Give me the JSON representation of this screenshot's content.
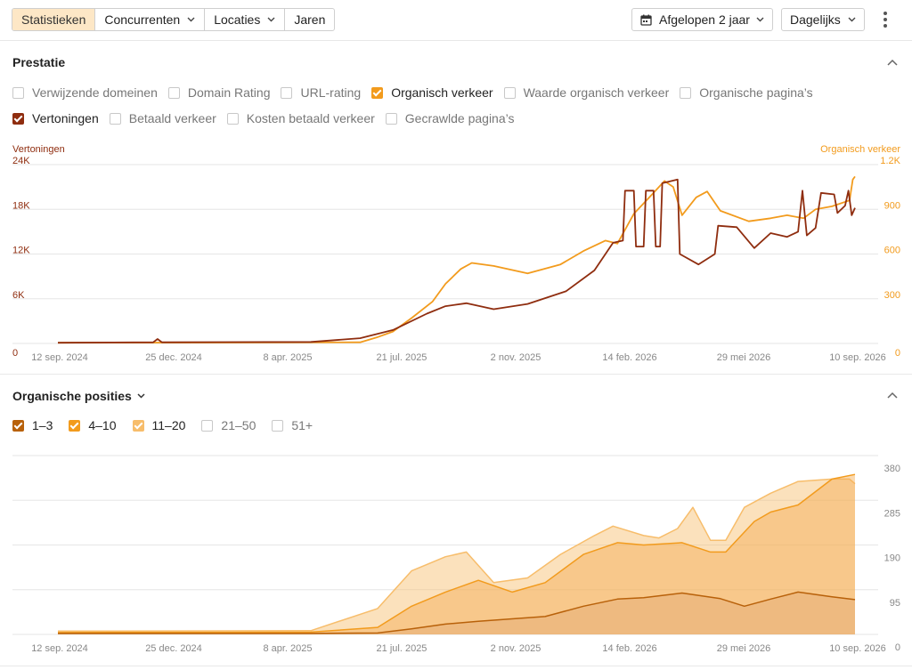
{
  "toolbar": {
    "tabs": [
      {
        "label": "Statistieken",
        "active": true,
        "has_dropdown": false
      },
      {
        "label": "Concurrenten",
        "active": false,
        "has_dropdown": true
      },
      {
        "label": "Locaties",
        "active": false,
        "has_dropdown": true
      },
      {
        "label": "Jaren",
        "active": false,
        "has_dropdown": false
      }
    ],
    "period_label": "Afgelopen 2 jaar",
    "interval_label": "Dagelijks",
    "icons": {
      "period": "calendar-icon",
      "chevron": "chevron-down-icon",
      "more": "kebab-menu-icon"
    }
  },
  "performance": {
    "title": "Prestatie",
    "metrics": [
      {
        "label": "Verwijzende domeinen",
        "checked": false,
        "color": ""
      },
      {
        "label": "Domain Rating",
        "checked": false,
        "color": ""
      },
      {
        "label": "URL-rating",
        "checked": false,
        "color": ""
      },
      {
        "label": "Organisch verkeer",
        "checked": true,
        "color": "#f29b1d"
      },
      {
        "label": "Waarde organisch verkeer",
        "checked": false,
        "color": ""
      },
      {
        "label": "Organische pagina’s",
        "checked": false,
        "color": ""
      },
      {
        "label": "Vertoningen",
        "checked": true,
        "color": "#8f2d0f"
      },
      {
        "label": "Betaald verkeer",
        "checked": false,
        "color": ""
      },
      {
        "label": "Kosten betaald verkeer",
        "checked": false,
        "color": ""
      },
      {
        "label": "Gecrawlde pagina’s",
        "checked": false,
        "color": ""
      }
    ],
    "left_axis_title": "Vertoningen",
    "right_axis_title": "Organisch verkeer"
  },
  "positions": {
    "title": "Organische posities",
    "buckets": [
      {
        "label": "1–3",
        "checked": true,
        "color": "#b8610a"
      },
      {
        "label": "4–10",
        "checked": true,
        "color": "#f29b1d"
      },
      {
        "label": "11–20",
        "checked": true,
        "color": "#f7bd6b"
      },
      {
        "label": "21–50",
        "checked": false,
        "color": ""
      },
      {
        "label": "51+",
        "checked": false,
        "color": ""
      }
    ]
  },
  "colors": {
    "accent": "#f29b1d",
    "accent_dark": "#8f2d0f",
    "active_tab_bg": "#fde7c6"
  },
  "chart_data": [
    {
      "type": "line",
      "x_tick_labels": [
        "12 sep. 2024",
        "25 dec. 2024",
        "8 apr. 2025",
        "21 jul. 2025",
        "2 nov. 2025",
        "14 feb. 2026",
        "29 mei 2026",
        "10 sep. 2026"
      ],
      "x_range": [
        "2024-09-12",
        "2026-09-10"
      ],
      "y_left": {
        "title": "Vertoningen",
        "ticks": [
          "0",
          "6K",
          "12K",
          "18K",
          "24K"
        ],
        "range": [
          0,
          24000
        ]
      },
      "y_right": {
        "title": "Organisch verkeer",
        "ticks": [
          "0",
          "300",
          "600",
          "900",
          "1.2K"
        ],
        "range": [
          0,
          1200
        ]
      },
      "grid": true,
      "series": [
        {
          "name": "Organisch verkeer",
          "axis": "right",
          "color": "#f29b1d",
          "points": [
            [
              "2024-09-12",
              5
            ],
            [
              "2025-06-15",
              8
            ],
            [
              "2025-06-30",
              40
            ],
            [
              "2025-07-15",
              80
            ],
            [
              "2025-08-01",
              170
            ],
            [
              "2025-08-20",
              280
            ],
            [
              "2025-09-01",
              400
            ],
            [
              "2025-09-15",
              500
            ],
            [
              "2025-09-25",
              540
            ],
            [
              "2025-10-15",
              520
            ],
            [
              "2025-11-15",
              470
            ],
            [
              "2025-12-15",
              530
            ],
            [
              "2026-01-05",
              620
            ],
            [
              "2026-01-25",
              690
            ],
            [
              "2026-02-05",
              670
            ],
            [
              "2026-02-20",
              870
            ],
            [
              "2026-03-10",
              1010
            ],
            [
              "2026-03-20",
              1090
            ],
            [
              "2026-03-28",
              1050
            ],
            [
              "2026-04-05",
              860
            ],
            [
              "2026-04-18",
              980
            ],
            [
              "2026-04-28",
              1020
            ],
            [
              "2026-05-10",
              890
            ],
            [
              "2026-06-05",
              820
            ],
            [
              "2026-06-25",
              840
            ],
            [
              "2026-07-10",
              860
            ],
            [
              "2026-07-25",
              840
            ],
            [
              "2026-08-05",
              900
            ],
            [
              "2026-08-20",
              920
            ],
            [
              "2026-09-05",
              960
            ],
            [
              "2026-09-08",
              1100
            ],
            [
              "2026-09-10",
              1120
            ]
          ]
        },
        {
          "name": "Vertoningen",
          "axis": "left",
          "color": "#8f2d0f",
          "points": [
            [
              "2024-09-12",
              100
            ],
            [
              "2024-12-08",
              150
            ],
            [
              "2024-12-12",
              600
            ],
            [
              "2024-12-16",
              150
            ],
            [
              "2025-05-01",
              200
            ],
            [
              "2025-06-15",
              700
            ],
            [
              "2025-07-15",
              1800
            ],
            [
              "2025-08-15",
              4000
            ],
            [
              "2025-09-01",
              5000
            ],
            [
              "2025-09-20",
              5400
            ],
            [
              "2025-10-15",
              4600
            ],
            [
              "2025-11-15",
              5300
            ],
            [
              "2025-12-20",
              7000
            ],
            [
              "2026-01-15",
              9800
            ],
            [
              "2026-02-01",
              13500
            ],
            [
              "2026-02-10",
              13800
            ],
            [
              "2026-02-12",
              20500
            ],
            [
              "2026-02-20",
              20500
            ],
            [
              "2026-02-22",
              13000
            ],
            [
              "2026-03-01",
              13000
            ],
            [
              "2026-03-03",
              20500
            ],
            [
              "2026-03-10",
              20500
            ],
            [
              "2026-03-12",
              13000
            ],
            [
              "2026-03-16",
              13000
            ],
            [
              "2026-03-18",
              21500
            ],
            [
              "2026-04-01",
              22000
            ],
            [
              "2026-04-03",
              12000
            ],
            [
              "2026-04-20",
              10600
            ],
            [
              "2026-05-05",
              12000
            ],
            [
              "2026-05-08",
              15800
            ],
            [
              "2026-05-25",
              15600
            ],
            [
              "2026-06-10",
              12800
            ],
            [
              "2026-06-25",
              14800
            ],
            [
              "2026-07-10",
              14300
            ],
            [
              "2026-07-20",
              15000
            ],
            [
              "2026-07-24",
              20500
            ],
            [
              "2026-07-28",
              14500
            ],
            [
              "2026-08-05",
              15500
            ],
            [
              "2026-08-10",
              20200
            ],
            [
              "2026-08-22",
              20000
            ],
            [
              "2026-08-25",
              17500
            ],
            [
              "2026-09-01",
              18500
            ],
            [
              "2026-09-04",
              20500
            ],
            [
              "2026-09-07",
              17200
            ],
            [
              "2026-09-10",
              18200
            ]
          ]
        }
      ]
    },
    {
      "type": "area",
      "stacked": true,
      "x_tick_labels": [
        "12 sep. 2024",
        "25 dec. 2024",
        "8 apr. 2025",
        "21 jul. 2025",
        "2 nov. 2025",
        "14 feb. 2026",
        "29 mei 2026",
        "10 sep. 2026"
      ],
      "x_range": [
        "2024-09-12",
        "2026-09-10"
      ],
      "y_right": {
        "ticks": [
          "0",
          "95",
          "190",
          "285",
          "380"
        ],
        "range": [
          0,
          380
        ]
      },
      "grid": true,
      "series": [
        {
          "name": "1–3",
          "color": "#b8610a",
          "points": [
            [
              "2024-09-12",
              2
            ],
            [
              "2025-05-01",
              2
            ],
            [
              "2025-07-01",
              3
            ],
            [
              "2025-08-01",
              12
            ],
            [
              "2025-09-01",
              22
            ],
            [
              "2025-10-01",
              28
            ],
            [
              "2025-11-01",
              33
            ],
            [
              "2025-12-01",
              38
            ],
            [
              "2026-01-05",
              60
            ],
            [
              "2026-02-05",
              75
            ],
            [
              "2026-03-01",
              78
            ],
            [
              "2026-04-05",
              88
            ],
            [
              "2026-05-10",
              76
            ],
            [
              "2026-06-01",
              60
            ],
            [
              "2026-06-25",
              75
            ],
            [
              "2026-07-20",
              90
            ],
            [
              "2026-08-20",
              80
            ],
            [
              "2026-09-10",
              74
            ]
          ]
        },
        {
          "name": "4–10",
          "color": "#f29b1d",
          "points": [
            [
              "2024-09-12",
              4
            ],
            [
              "2025-05-01",
              5
            ],
            [
              "2025-07-01",
              15
            ],
            [
              "2025-08-01",
              60
            ],
            [
              "2025-09-01",
              90
            ],
            [
              "2025-10-01",
              115
            ],
            [
              "2025-11-01",
              90
            ],
            [
              "2025-12-01",
              110
            ],
            [
              "2026-01-05",
              170
            ],
            [
              "2026-02-05",
              195
            ],
            [
              "2026-03-01",
              190
            ],
            [
              "2026-04-05",
              195
            ],
            [
              "2026-05-01",
              175
            ],
            [
              "2026-05-15",
              175
            ],
            [
              "2026-06-10",
              240
            ],
            [
              "2026-06-25",
              260
            ],
            [
              "2026-07-20",
              275
            ],
            [
              "2026-08-20",
              330
            ],
            [
              "2026-09-10",
              340
            ]
          ]
        },
        {
          "name": "11–20",
          "color": "#f7bd6b",
          "points": [
            [
              "2024-09-12",
              7
            ],
            [
              "2025-05-01",
              8
            ],
            [
              "2025-07-01",
              55
            ],
            [
              "2025-08-01",
              135
            ],
            [
              "2025-09-01",
              165
            ],
            [
              "2025-09-20",
              175
            ],
            [
              "2025-10-15",
              110
            ],
            [
              "2025-11-15",
              120
            ],
            [
              "2025-12-15",
              170
            ],
            [
              "2026-01-15",
              210
            ],
            [
              "2026-02-01",
              230
            ],
            [
              "2026-03-01",
              210
            ],
            [
              "2026-03-15",
              205
            ],
            [
              "2026-04-01",
              225
            ],
            [
              "2026-04-15",
              270
            ],
            [
              "2026-05-01",
              200
            ],
            [
              "2026-05-15",
              200
            ],
            [
              "2026-06-01",
              270
            ],
            [
              "2026-06-25",
              300
            ],
            [
              "2026-07-20",
              325
            ],
            [
              "2026-08-20",
              330
            ],
            [
              "2026-09-05",
              330
            ],
            [
              "2026-09-10",
              320
            ]
          ]
        }
      ]
    }
  ]
}
